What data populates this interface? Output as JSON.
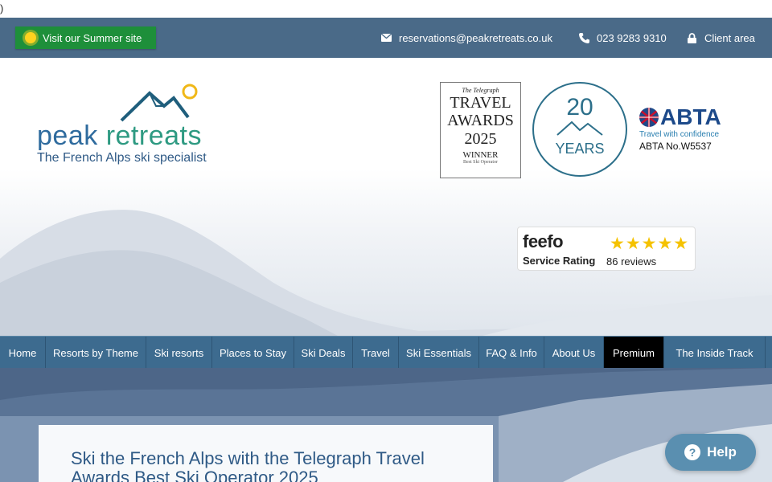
{
  "stray_text": ")",
  "topbar": {
    "summer_label": "Visit our Summer site",
    "email": "reservations@peakretreats.co.uk",
    "phone": "023 9283 9310",
    "client_area": "Client area"
  },
  "header": {
    "logo_word1": "peak",
    "logo_word2": "retreats",
    "tagline": "The French Alps ski specialist"
  },
  "awards": {
    "telegraph_masthead": "The Telegraph",
    "telegraph_line1": "TRAVEL",
    "telegraph_line2": "AWARDS",
    "telegraph_year": "2025",
    "telegraph_winner": "WINNER",
    "telegraph_category": "Best Ski Operator",
    "years_num": "20",
    "years_label": "YEARS",
    "abta_brand": "ABTA",
    "abta_sub": "Travel with confidence",
    "abta_no": "ABTA No.W5537"
  },
  "feefo": {
    "brand": "feefo",
    "label": "Service Rating",
    "stars": "★★★★★",
    "reviews": "86 reviews"
  },
  "nav": {
    "items": [
      {
        "label": "Home"
      },
      {
        "label": "Resorts by Theme"
      },
      {
        "label": "Ski resorts"
      },
      {
        "label": "Places to Stay"
      },
      {
        "label": "Ski Deals"
      },
      {
        "label": "Travel"
      },
      {
        "label": "Ski Essentials"
      },
      {
        "label": "FAQ & Info"
      },
      {
        "label": "About Us"
      },
      {
        "label": "Premium"
      },
      {
        "label": "The Inside Track"
      }
    ]
  },
  "hero": {
    "headline": "Ski the French Alps with the Telegraph Travel Awards Best Ski Operator 2025"
  },
  "help": {
    "label": "Help"
  },
  "colors": {
    "topbar": "#4a6a88",
    "summer_button": "#1e8f3a",
    "nav": "#3d6b8f",
    "nav_active": "#000000",
    "brand_blue": "#2f6b9e",
    "brand_green": "#2e9a82"
  },
  "icons": {
    "summer": "sun-icon",
    "email": "envelope-icon",
    "phone": "phone-icon",
    "client": "lock-icon",
    "help": "question-icon"
  }
}
